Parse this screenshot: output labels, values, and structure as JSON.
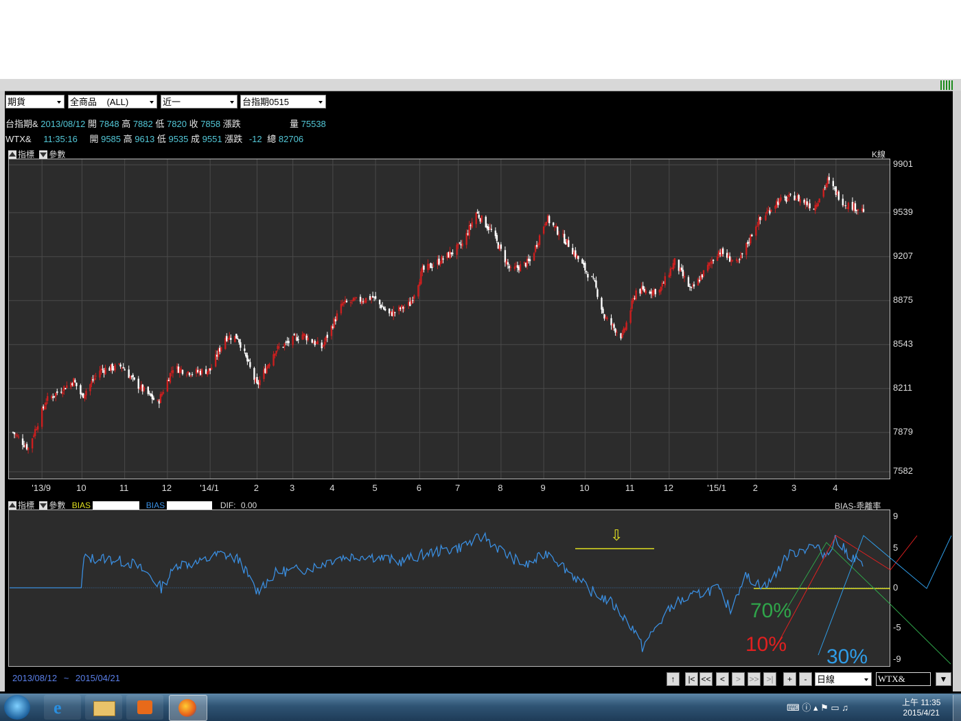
{
  "toolbar": {
    "combos": [
      {
        "value": "期貨"
      },
      {
        "value": "全商品    (ALL)"
      },
      {
        "value": "近一"
      },
      {
        "value": "台指期0515"
      }
    ]
  },
  "info": {
    "row1": {
      "name": "台指期&",
      "date": "2013/08/12",
      "open_lbl": "開",
      "open": "7848",
      "high_lbl": "高",
      "high": "7882",
      "low_lbl": "低",
      "low": "7820",
      "close_lbl": "收",
      "close": "7858",
      "change_lbl": "漲跌",
      "vol_lbl": "量",
      "vol": "75538"
    },
    "row2": {
      "name": "WTX&",
      "time": "11:35:16",
      "open_lbl": "開",
      "open": "9585",
      "high_lbl": "高",
      "high": "9613",
      "low_lbl": "低",
      "low": "9535",
      "close_lbl": "成",
      "close": "9551",
      "change_lbl": "漲跌",
      "change": "-12",
      "total_lbl": "總",
      "total": "82706"
    }
  },
  "main_panel": {
    "indicator_lbl": "指標",
    "param_lbl": "參數",
    "right_label": "K線",
    "ytick_labels": [
      "9901",
      "9539",
      "9207",
      "8875",
      "8543",
      "8211",
      "7879",
      "7582"
    ],
    "xtick_labels": [
      "'13/9",
      "10",
      "11",
      "12",
      "'14/1",
      "2",
      "3",
      "4",
      "5",
      "6",
      "7",
      "8",
      "9",
      "10",
      "11",
      "12",
      "'15/1",
      "2",
      "3",
      "4"
    ]
  },
  "sub_panel": {
    "indicator_lbl": "指標",
    "param_lbl": "參數",
    "bias1_lbl": "BIAS",
    "bias2_lbl": "BIAS",
    "dif_lbl": "DIF:",
    "dif_val": "0.00",
    "right_label": "BIAS-乖離率",
    "ytick_labels": [
      "9",
      "5",
      "0",
      "-5",
      "-9"
    ],
    "annotations": {
      "pct70": "70%",
      "pct10": "10%",
      "pct30": "30%",
      "arrow": "⇩"
    }
  },
  "bottom": {
    "range_start": "2013/08/12",
    "range_sep": "~",
    "range_end": "2015/04/21",
    "nav_buttons": [
      "|<",
      "<<",
      "<",
      ">",
      ">>",
      ">|"
    ],
    "zoom_in": "+",
    "zoom_out": "-",
    "period": "日線",
    "symbol": "WTX&"
  },
  "taskbar": {
    "ampm": "上午 11:35",
    "date": "2015/4/21"
  },
  "colors": {
    "up": "#cc1f1f",
    "down": "#ffffff",
    "bias": "#3a8ee0",
    "accent_yellow": "#e0e020",
    "green": "#2fa64a",
    "red": "#e02020",
    "blue": "#2f9de8"
  },
  "chart_data": [
    {
      "type": "candlestick",
      "title": "",
      "ylabel": "",
      "xlabel": "",
      "ylim": [
        7582,
        9901
      ],
      "yticks": [
        9901,
        9539,
        9207,
        8875,
        8543,
        8211,
        7879,
        7582
      ],
      "xlim": [
        "2013-08-12",
        "2015-04-21"
      ],
      "xtick_labels": [
        "'13/9",
        "10",
        "11",
        "12",
        "'14/1",
        "2",
        "3",
        "4",
        "5",
        "6",
        "7",
        "8",
        "9",
        "10",
        "11",
        "12",
        "'15/1",
        "2",
        "3",
        "4"
      ],
      "close_anchors": [
        [
          "2013-08-12",
          7880
        ],
        [
          "2013-08-23",
          7760
        ],
        [
          "2013-09-05",
          8120
        ],
        [
          "2013-09-25",
          8270
        ],
        [
          "2013-10-01",
          8150
        ],
        [
          "2013-10-14",
          8350
        ],
        [
          "2013-10-30",
          8380
        ],
        [
          "2013-11-08",
          8260
        ],
        [
          "2013-11-25",
          8100
        ],
        [
          "2013-12-06",
          8370
        ],
        [
          "2013-12-20",
          8330
        ],
        [
          "2014-01-02",
          8350
        ],
        [
          "2014-01-13",
          8600
        ],
        [
          "2014-01-22",
          8600
        ],
        [
          "2014-02-05",
          8230
        ],
        [
          "2014-02-18",
          8500
        ],
        [
          "2014-03-10",
          8620
        ],
        [
          "2014-03-24",
          8520
        ],
        [
          "2014-04-08",
          8850
        ],
        [
          "2014-04-30",
          8900
        ],
        [
          "2014-05-12",
          8770
        ],
        [
          "2014-05-27",
          8850
        ],
        [
          "2014-06-05",
          9100
        ],
        [
          "2014-06-20",
          9190
        ],
        [
          "2014-07-04",
          9300
        ],
        [
          "2014-07-14",
          9540
        ],
        [
          "2014-07-25",
          9400
        ],
        [
          "2014-08-08",
          9100
        ],
        [
          "2014-08-22",
          9170
        ],
        [
          "2014-09-03",
          9500
        ],
        [
          "2014-09-19",
          9300
        ],
        [
          "2014-10-08",
          9000
        ],
        [
          "2014-10-15",
          8750
        ],
        [
          "2014-10-28",
          8600
        ],
        [
          "2014-11-07",
          8950
        ],
        [
          "2014-11-24",
          8950
        ],
        [
          "2014-12-05",
          9170
        ],
        [
          "2014-12-17",
          8950
        ],
        [
          "2015-01-06",
          9250
        ],
        [
          "2015-01-20",
          9150
        ],
        [
          "2015-02-02",
          9450
        ],
        [
          "2015-02-17",
          9620
        ],
        [
          "2015-03-02",
          9660
        ],
        [
          "2015-03-16",
          9580
        ],
        [
          "2015-03-26",
          9780
        ],
        [
          "2015-04-07",
          9610
        ],
        [
          "2015-04-21",
          9560
        ]
      ]
    },
    {
      "type": "line",
      "title": "",
      "ylim": [
        -9,
        9
      ],
      "yticks": [
        9,
        5,
        0,
        -5,
        -9
      ],
      "series": [
        {
          "name": "BIAS",
          "start": "2013-10-01",
          "anchors": [
            [
              "2013-10-01",
              0
            ],
            [
              "2013-10-03",
              3.7
            ],
            [
              "2013-10-20",
              3.7
            ],
            [
              "2013-11-08",
              3.0
            ],
            [
              "2013-11-20",
              1.5
            ],
            [
              "2013-11-28",
              0
            ],
            [
              "2013-12-10",
              3.0
            ],
            [
              "2013-12-25",
              3.1
            ],
            [
              "2014-01-10",
              4.3
            ],
            [
              "2014-01-24",
              3.5
            ],
            [
              "2014-02-05",
              -0.5
            ],
            [
              "2014-02-20",
              2.0
            ],
            [
              "2014-03-15",
              2.4
            ],
            [
              "2014-04-05",
              3.8
            ],
            [
              "2014-04-25",
              4.1
            ],
            [
              "2014-05-20",
              3.3
            ],
            [
              "2014-06-10",
              4.4
            ],
            [
              "2014-07-01",
              5.0
            ],
            [
              "2014-07-20",
              6.5
            ],
            [
              "2014-08-05",
              4.2
            ],
            [
              "2014-08-20",
              2.8
            ],
            [
              "2014-09-05",
              4.5
            ],
            [
              "2014-09-20",
              2.0
            ],
            [
              "2014-10-05",
              -0.3
            ],
            [
              "2014-10-20",
              -1.8
            ],
            [
              "2014-11-05",
              -5.0
            ],
            [
              "2014-11-12",
              -7.5
            ],
            [
              "2014-11-20",
              -5.5
            ],
            [
              "2014-12-05",
              -2.0
            ],
            [
              "2014-12-20",
              -1.0
            ],
            [
              "2015-01-05",
              0.0
            ],
            [
              "2015-01-15",
              -2.7
            ],
            [
              "2015-01-25",
              1.5
            ],
            [
              "2015-02-10",
              0.1
            ],
            [
              "2015-02-25",
              4.0
            ],
            [
              "2015-03-15",
              5.3
            ],
            [
              "2015-03-25",
              4.2
            ],
            [
              "2015-04-01",
              6.2
            ],
            [
              "2015-04-10",
              4.3
            ],
            [
              "2015-04-21",
              3.0
            ]
          ]
        }
      ],
      "annotations": [
        "70%",
        "10%",
        "30%"
      ]
    }
  ]
}
